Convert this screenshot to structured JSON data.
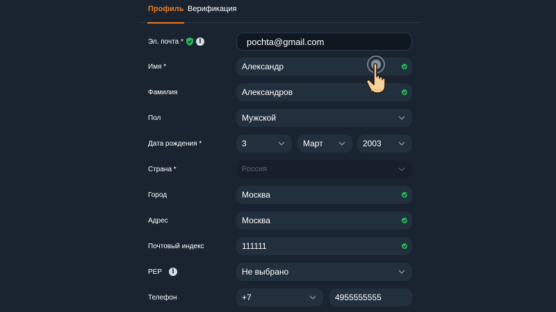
{
  "tabs": [
    {
      "label": "Профиль",
      "active": true
    },
    {
      "label": "Верификация",
      "active": false
    }
  ],
  "form": {
    "email": {
      "label": "Эл. почта *",
      "value": "pochta@gmail.com"
    },
    "first_name": {
      "label": "Имя *",
      "value": "Александр"
    },
    "last_name": {
      "label": "Фамилия",
      "value": "Александров"
    },
    "gender": {
      "label": "Пол",
      "value": "Мужской"
    },
    "birth_date": {
      "label": "Дата рождения *",
      "day": "3",
      "month": "Март",
      "year": "2003"
    },
    "country": {
      "label": "Страна *",
      "value": "Россия"
    },
    "city": {
      "label": "Город",
      "value": "Москва"
    },
    "address": {
      "label": "Адрес",
      "value": "Москва"
    },
    "postal_code": {
      "label": "Почтовый индекс",
      "value": "111111"
    },
    "pep": {
      "label": "PEP",
      "value": "Не выбрано"
    },
    "phone": {
      "label": "Телефон",
      "code": "+7",
      "number": "4955555555"
    }
  },
  "colors": {
    "accent": "#ec7c1f",
    "background": "#1a2431",
    "input_bg": "#222f3d",
    "valid_check": "#27b85a"
  },
  "icons": [
    "shield-check-icon",
    "info-icon",
    "check-icon",
    "chevron-down-icon",
    "pointer-hand-icon"
  ]
}
